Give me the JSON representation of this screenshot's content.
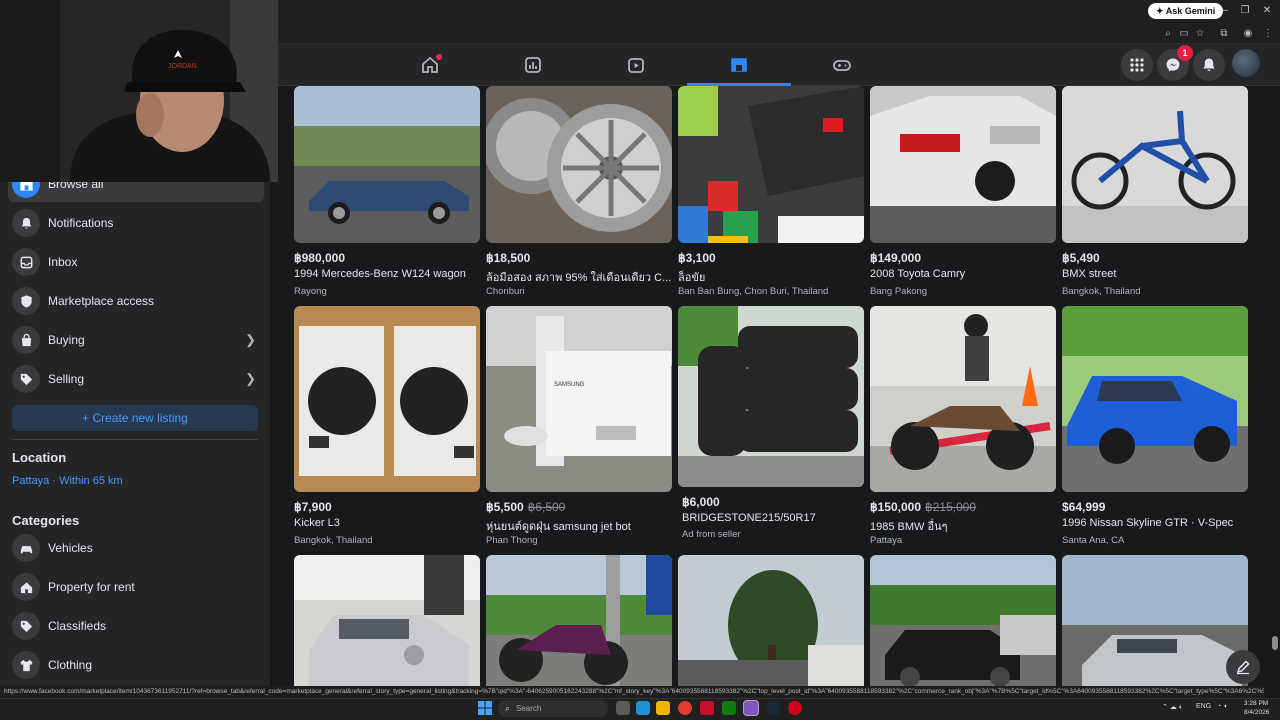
{
  "browser": {
    "gemini_label": "✦ Ask Gemini",
    "status_url": "https://www.facebook.com/marketplace/item/1043673611952711/?ref=browse_tab&referral_code=marketplace_general&referral_story_type=general_listing&tracking=%7B\"qid\"%3A\"-6406259005162243288\"%2C\"mf_story_key\"%3A\"6400935588118593382\"%2C\"top_level_post_id\"%3A\"6400935588118593382\"%2C\"commerce_rank_obj\"%3A\"%7B%5C\"target_id%5C\"%3A6400935588118593382%2C%5C\"target_type%5C\"%3A6%2C%5C\"primary_position%5C\"%3A132%2C%5C\"ra..."
  },
  "header": {
    "messenger_badge": "1"
  },
  "sidebar": {
    "items": [
      {
        "label": "Browse all",
        "icon": "storefront-icon"
      },
      {
        "label": "Notifications",
        "icon": "bell-icon"
      },
      {
        "label": "Inbox",
        "icon": "inbox-icon"
      },
      {
        "label": "Marketplace access",
        "icon": "shield-icon"
      },
      {
        "label": "Buying",
        "icon": "bag-icon"
      },
      {
        "label": "Selling",
        "icon": "tag-icon"
      }
    ],
    "create_label": "+ Create new listing",
    "location_heading": "Location",
    "location_value": "Pattaya · Within 65 km",
    "categories_heading": "Categories",
    "categories": [
      {
        "label": "Vehicles",
        "icon": "car-icon"
      },
      {
        "label": "Property for rent",
        "icon": "house-icon"
      },
      {
        "label": "Classifieds",
        "icon": "tag-icon"
      },
      {
        "label": "Clothing",
        "icon": "shirt-icon"
      }
    ]
  },
  "listings": [
    {
      "price": "฿980,000",
      "old_price": "",
      "title": "1994 Mercedes-Benz W124 wagon",
      "location": "Rayong"
    },
    {
      "price": "฿18,500",
      "old_price": "",
      "title": "ล้อมือสอง สภาพ 95% ใส่เดือนเดียว C...",
      "location": "Chonburi"
    },
    {
      "price": "฿3,100",
      "old_price": "",
      "title": "ล็อขัย",
      "location": "Ban Ban Bung, Chon Buri, Thailand"
    },
    {
      "price": "฿149,000",
      "old_price": "",
      "title": "2008 Toyota Camry",
      "location": "Bang Pakong"
    },
    {
      "price": "฿5,490",
      "old_price": "",
      "title": "BMX street",
      "location": "Bangkok, Thailand"
    },
    {
      "price": "฿7,900",
      "old_price": "",
      "title": "Kicker L3",
      "location": "Bangkok, Thailand"
    },
    {
      "price": "฿5,500",
      "old_price": "฿6,500",
      "title": "หุ่นยนต์ดูดฝุ่น samsung jet bot",
      "location": "Phan Thong"
    },
    {
      "price": "฿6,000",
      "old_price": "",
      "title": "BRIDGESTONE215/50R17",
      "location": "Ad from seller"
    },
    {
      "price": "฿150,000",
      "old_price": "฿215,000",
      "title": "1985 BMW อื่นๆ",
      "location": "Pattaya"
    },
    {
      "price": "$64,999",
      "old_price": "",
      "title": "1996 Nissan Skyline GTR · V-Spec",
      "location": "Santa Ana, CA"
    }
  ],
  "taskbar": {
    "search_placeholder": "Search",
    "lang": "ENG",
    "time": "3:28 PM",
    "date": "8/4/2026"
  },
  "colors": {
    "accent": "#2d88ff",
    "background": "#18191a",
    "surface": "#242526"
  }
}
